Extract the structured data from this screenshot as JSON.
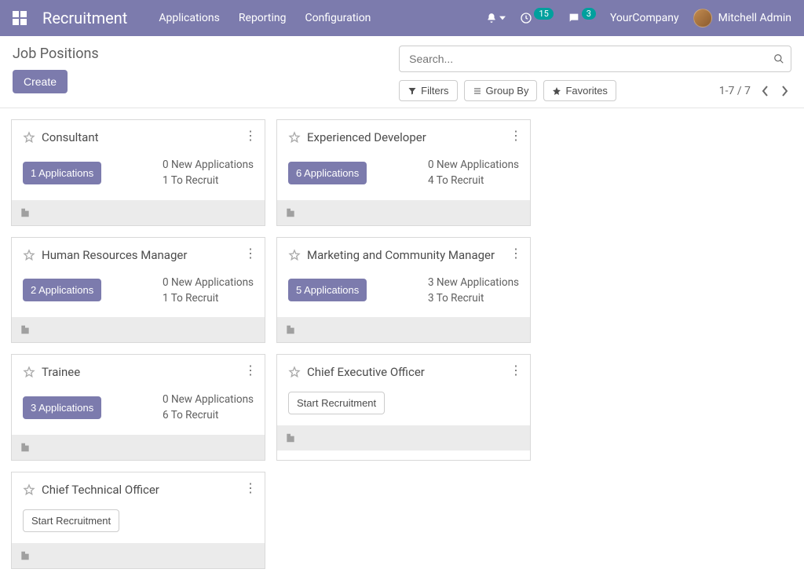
{
  "navbar": {
    "brand": "Recruitment",
    "links": {
      "applications": "Applications",
      "reporting": "Reporting",
      "configuration": "Configuration"
    },
    "activities_badge": "15",
    "discuss_badge": "3",
    "company": "YourCompany",
    "user": "Mitchell Admin"
  },
  "controlbar": {
    "title": "Job Positions",
    "create_label": "Create",
    "search_placeholder": "Search...",
    "filters_label": "Filters",
    "groupby_label": "Group By",
    "favorites_label": "Favorites",
    "pager_text": "1-7 / 7"
  },
  "cards": [
    {
      "title": "Consultant",
      "apps_btn": "1 Applications",
      "stat1": "0 New Applications",
      "stat2": "1 To Recruit",
      "start": false
    },
    {
      "title": "Experienced Developer",
      "apps_btn": "6 Applications",
      "stat1": "0 New Applications",
      "stat2": "4 To Recruit",
      "start": false
    },
    {
      "title": "Human Resources Manager",
      "apps_btn": "2 Applications",
      "stat1": "0 New Applications",
      "stat2": "1 To Recruit",
      "start": false
    },
    {
      "title": "Marketing and Community Manager",
      "apps_btn": "5 Applications",
      "stat1": "3 New Applications",
      "stat2": "3 To Recruit",
      "start": false
    },
    {
      "title": "Trainee",
      "apps_btn": "3 Applications",
      "stat1": "0 New Applications",
      "stat2": "6 To Recruit",
      "start": false
    },
    {
      "title": "Chief Executive Officer",
      "start": true,
      "start_label": "Start Recruitment"
    },
    {
      "title": "Chief Technical Officer",
      "start": true,
      "start_label": "Start Recruitment"
    }
  ]
}
